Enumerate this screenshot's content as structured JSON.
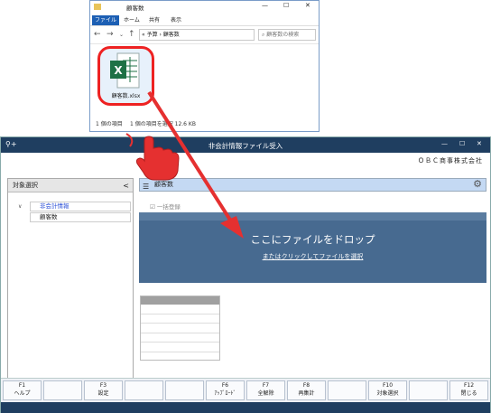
{
  "explorer": {
    "title": "顧客数",
    "tabs": [
      "ファイル",
      "ホーム",
      "共有",
      "表示"
    ],
    "breadcrumb": "« 予算 › 顧客数",
    "search_placeholder": "顧客数の検索",
    "file_name": "顧客数.xlsx",
    "status_left": "1 個の項目",
    "status_right": "1 個の項目を選択 12.6 KB",
    "title_minimize": "—",
    "title_maximize": "☐",
    "title_close": "✕"
  },
  "app": {
    "title": "非会計情報ファイル受入",
    "company": "ＯＢＣ商事株式会社",
    "left_header": "対象選択",
    "collapse_glyph": "<",
    "tree_parent": "非会計情報",
    "tree_child": "顧客数",
    "right_header": "顧客数",
    "ikkatsu": "一括登録",
    "drop_main": "ここにファイルをドロップ",
    "drop_link": "またはクリックしてファイルを選択",
    "title_minimize": "—",
    "title_maximize": "☐",
    "title_close": "✕",
    "fkeys": [
      {
        "key": "F1",
        "label": "ヘルプ"
      },
      {
        "key": "",
        "label": ""
      },
      {
        "key": "F3",
        "label": "設定"
      },
      {
        "key": "",
        "label": ""
      },
      {
        "key": "",
        "label": ""
      },
      {
        "key": "F6",
        "label": "ｱｯﾌﾟﾛｰﾄﾞ"
      },
      {
        "key": "F7",
        "label": "全解除"
      },
      {
        "key": "F8",
        "label": "再集計"
      },
      {
        "key": "",
        "label": ""
      },
      {
        "key": "F10",
        "label": "対象選択"
      },
      {
        "key": "",
        "label": ""
      },
      {
        "key": "F12",
        "label": "閉じる"
      }
    ]
  },
  "colors": {
    "arrow": "#e53030",
    "app_title_bg": "#1f3e60",
    "drop_bg": "#476a90",
    "excel_green": "#1e7145"
  }
}
